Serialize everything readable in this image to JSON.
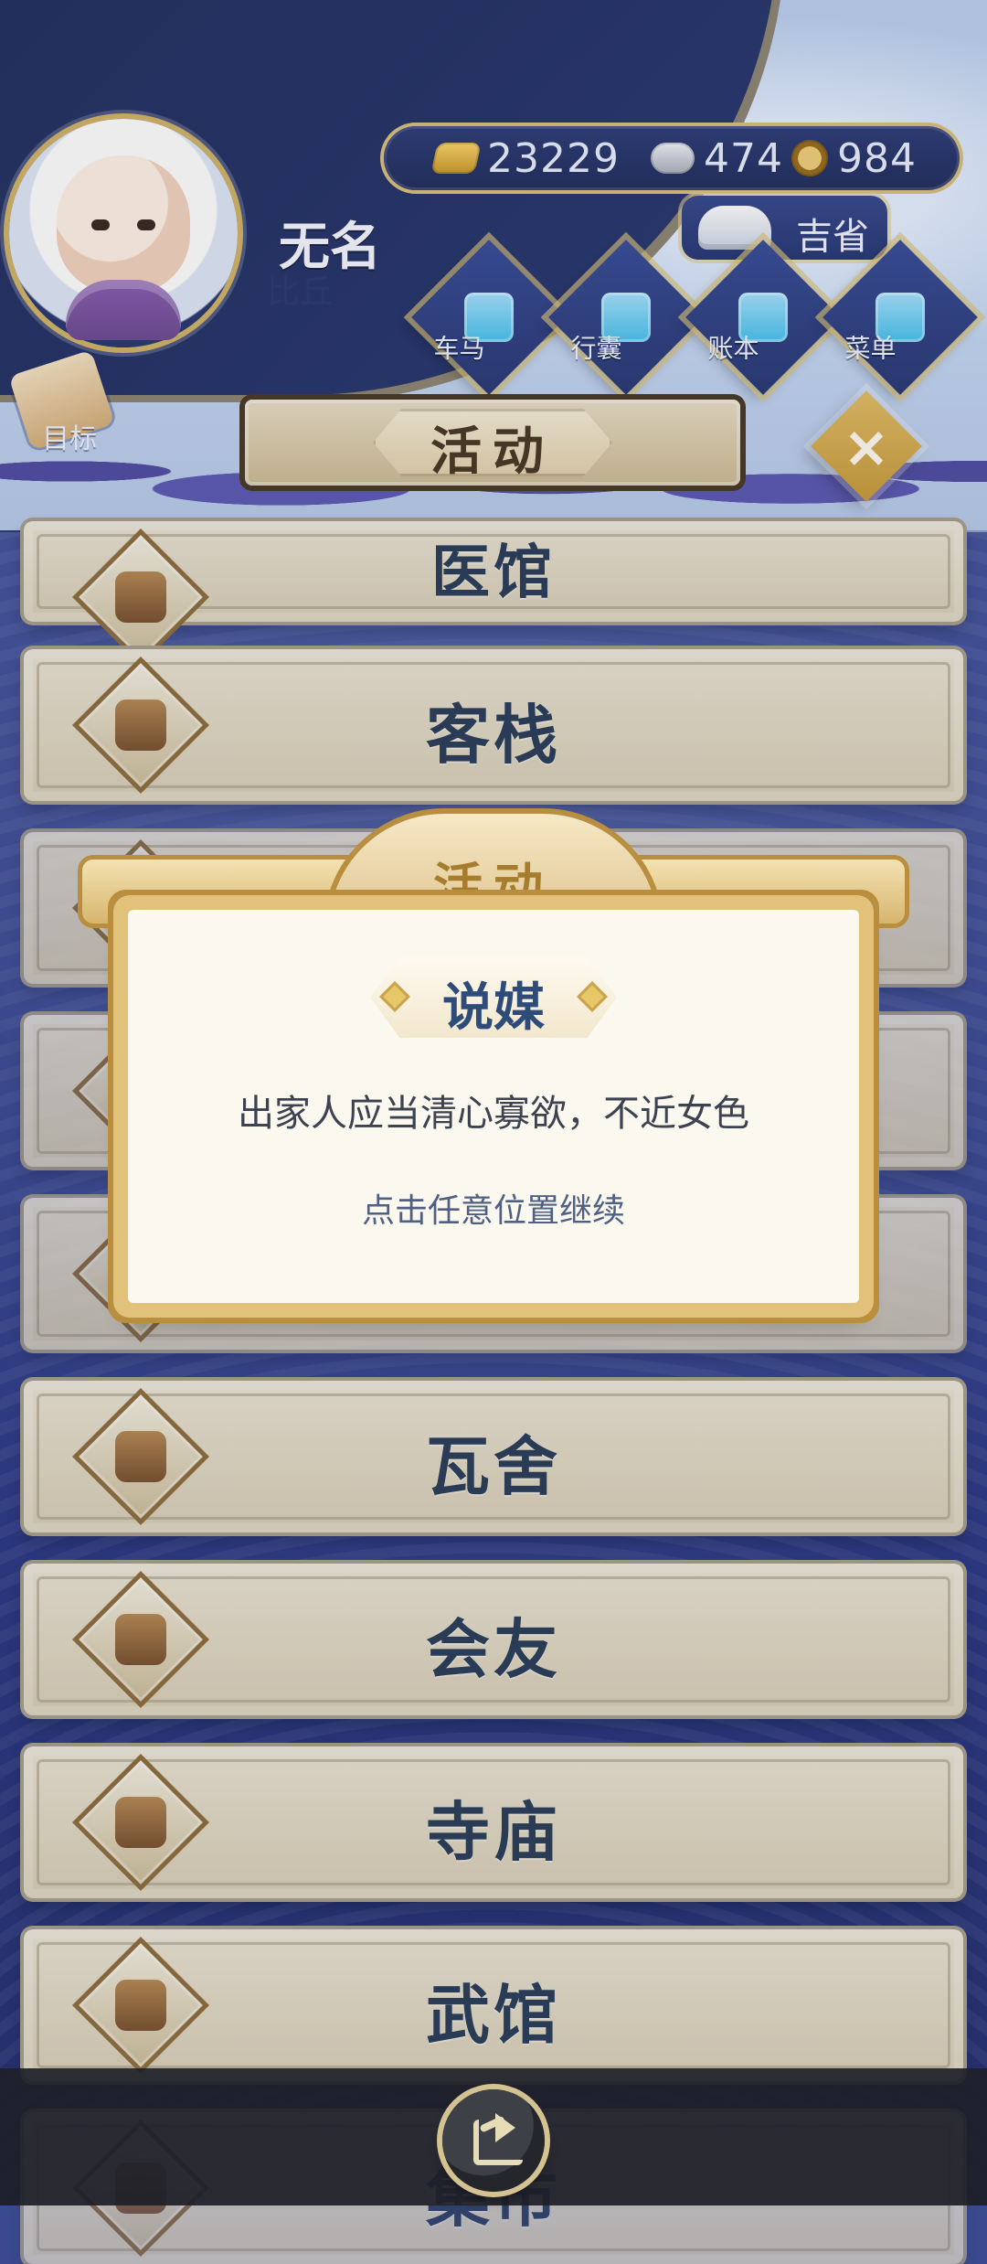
{
  "player": {
    "name": "无名",
    "rank": "比丘"
  },
  "currencies": {
    "gold": "23229",
    "silver": "474",
    "coins": "984"
  },
  "status": {
    "label": "吉省"
  },
  "top_menu": [
    {
      "label": "车马",
      "icon": "carriage-icon"
    },
    {
      "label": "行囊",
      "icon": "bag-icon"
    },
    {
      "label": "账本",
      "icon": "ledger-icon"
    },
    {
      "label": "菜单",
      "icon": "menu-icon"
    }
  ],
  "goal": {
    "label": "目标"
  },
  "header": {
    "title": "活动"
  },
  "activities": [
    {
      "label": "医馆"
    },
    {
      "label": "客栈"
    },
    {
      "label": ""
    },
    {
      "label": ""
    },
    {
      "label": ""
    },
    {
      "label": "瓦舍"
    },
    {
      "label": "会友"
    },
    {
      "label": "寺庙"
    },
    {
      "label": "武馆"
    },
    {
      "label": "集市"
    }
  ],
  "modal": {
    "header": "活动",
    "title": "说媒",
    "message": "出家人应当清心寡欲，不近女色",
    "continue_hint": "点击任意位置继续"
  },
  "colors": {
    "accent_gold": "#d7b66e",
    "navy": "#2c3b74",
    "text_dark": "#2c3f5b"
  }
}
